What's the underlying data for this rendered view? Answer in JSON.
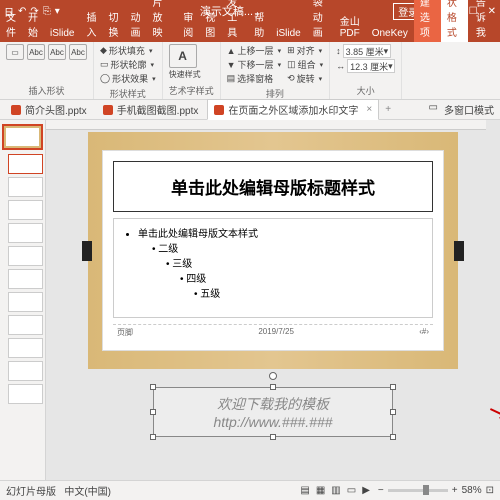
{
  "title": "演示文稿...",
  "login": "登录",
  "qat": [
    "日",
    "↶",
    "↷",
    "⎘",
    "▾"
  ],
  "tabs": [
    "文件",
    "开始",
    "iSlide",
    "插入",
    "切换",
    "动画",
    "幻灯片放映",
    "审阅",
    "视图",
    "开发工具",
    "帮助",
    "iSlide",
    "口袋动画",
    "金山PDF",
    "OneKey",
    "新建选项",
    "形状格式"
  ],
  "share": "告诉我",
  "ribbon": {
    "insert_shape": "插入形状",
    "shape_style": "形状样式",
    "wordart": "艺术字样式",
    "arrange": "排列",
    "size": "大小",
    "shape_fill": "形状填充",
    "shape_outline": "形状轮廓",
    "shape_effects": "形状效果",
    "quick_style": "快速样式",
    "bring_fwd": "上移一层",
    "send_back": "下移一层",
    "selection": "选择窗格",
    "align": "对齐",
    "group": "组合",
    "rotate": "旋转",
    "height": "3.85 厘米",
    "width": "12.3 厘米"
  },
  "doctabs": [
    {
      "name": "简介头图.pptx"
    },
    {
      "name": "手机截图截图.pptx"
    },
    {
      "name": "在页面之外区域添加水印文字",
      "active": true
    }
  ],
  "multiwin": "多窗口模式",
  "slide": {
    "title": "单击此处编辑母版标题样式",
    "l1": "单击此处编辑母版文本样式",
    "l2": "二级",
    "l3": "三级",
    "l4": "四级",
    "l5": "五级",
    "foot_left": "页脚",
    "foot_right": "2019/7/25"
  },
  "watermark": {
    "line1": "欢迎下载我的模板",
    "line2": "http://www.###.###"
  },
  "status": {
    "view": "幻灯片母版",
    "lang": "中文(中国)",
    "zoom": "58%"
  }
}
